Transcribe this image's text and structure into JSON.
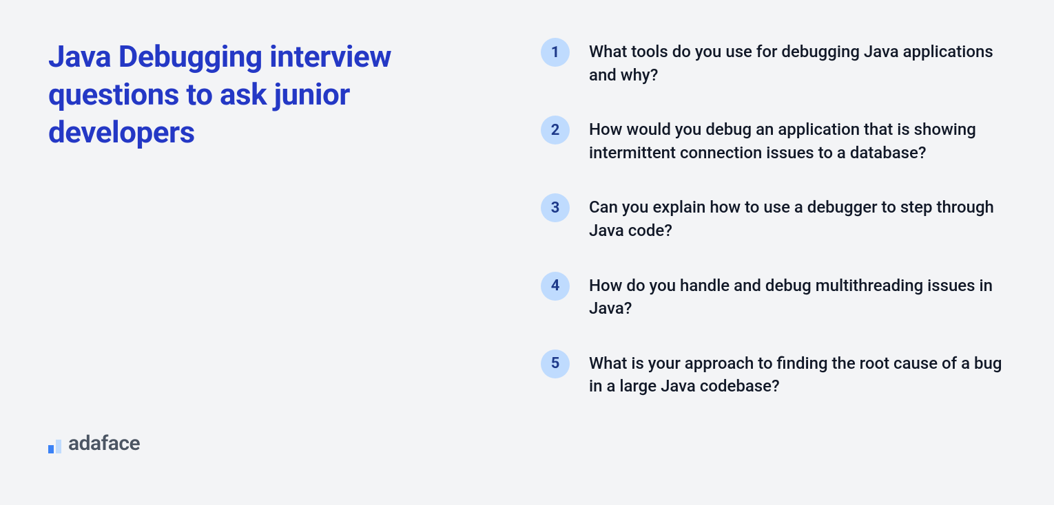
{
  "title": "Java Debugging interview questions to ask junior developers",
  "logo_text": "adaface",
  "questions": [
    {
      "number": "1",
      "text": "What tools do you use for debugging Java applications and why?"
    },
    {
      "number": "2",
      "text": "How would you debug an application that is showing intermittent connection issues to a database?"
    },
    {
      "number": "3",
      "text": "Can you explain how to use a debugger to step through Java code?"
    },
    {
      "number": "4",
      "text": "How do you handle and debug multithreading issues in Java?"
    },
    {
      "number": "5",
      "text": "What is your approach to finding the root cause of a bug in a large Java codebase?"
    }
  ]
}
